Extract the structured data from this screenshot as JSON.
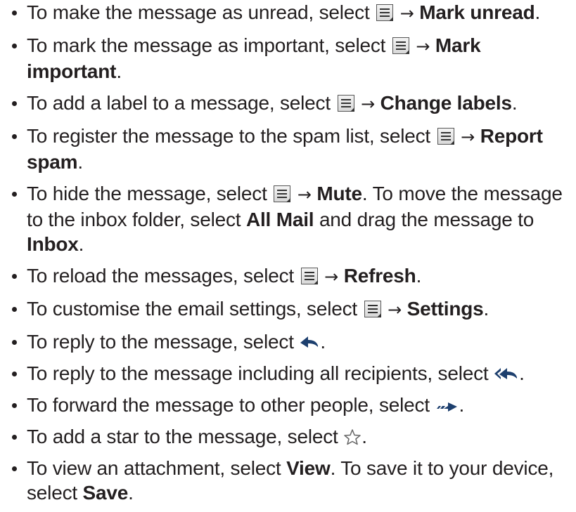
{
  "items": [
    {
      "pre": "To make the message as unread, select ",
      "arrow": "→",
      "bold": "Mark unread",
      "post": "."
    },
    {
      "pre": "To mark the message as important, select ",
      "arrow": "→",
      "bold": "Mark important",
      "post": "."
    },
    {
      "pre": "To add a label to a message, select ",
      "arrow": "→",
      "bold": "Change labels",
      "post": "."
    },
    {
      "pre": "To register the message to the spam list, select ",
      "arrow": "→",
      "bold": "Report spam",
      "post": "."
    },
    {
      "pre": "To hide the message, select ",
      "arrow": "→",
      "bold": "Mute",
      "mid": ". To move the message to the inbox folder, select ",
      "bold2": "All Mail",
      "mid2": " and drag the message to ",
      "bold3": "Inbox",
      "post": "."
    },
    {
      "pre": "To reload the messages, select ",
      "arrow": "→",
      "bold": "Refresh",
      "post": "."
    },
    {
      "pre": "To customise the email settings, select ",
      "arrow": "→",
      "bold": "Settings",
      "post": "."
    },
    {
      "pre": "To reply to the message, select ",
      "post": "."
    },
    {
      "pre": "To reply to the message including all recipients, select ",
      "post": "."
    },
    {
      "pre": "To forward the message to other people, select ",
      "post": "."
    },
    {
      "pre": "To add a star to the message, select ",
      "post": "."
    },
    {
      "pre": "To view an attachment, select ",
      "bold": "View",
      "mid": ". To save it to your device, select ",
      "bold2": "Save",
      "post": "."
    }
  ],
  "icons": {
    "menu": "menu-icon",
    "reply": "reply-icon",
    "reply_all": "reply-all-icon",
    "forward": "forward-icon",
    "star": "star-icon"
  }
}
